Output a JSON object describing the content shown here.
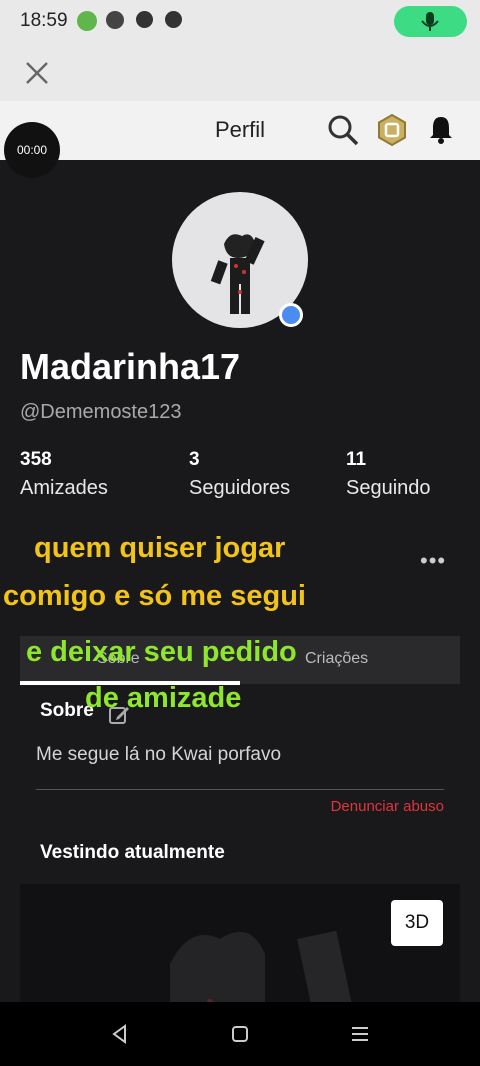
{
  "status_bar": {
    "time": "18:59"
  },
  "header": {
    "title": "Perfil",
    "recording_time": "00:00"
  },
  "profile": {
    "display_name": "Madarinha17",
    "username": "@Dememoste123"
  },
  "stats": [
    {
      "value": "358",
      "label": "Amizades"
    },
    {
      "value": "3",
      "label": "Seguidores"
    },
    {
      "value": "11",
      "label": "Seguindo"
    }
  ],
  "tabs": [
    {
      "label": "Sobre",
      "selected": true
    },
    {
      "label": "Criações",
      "selected": false
    }
  ],
  "about": {
    "title": "Sobre",
    "text": "Me segue lá no Kwai porfavo",
    "report_label": "Denunciar abuso"
  },
  "wearing": {
    "title": "Vestindo atualmente",
    "view_3d_label": "3D"
  },
  "overlay_caption": {
    "line1": "quem quiser jogar",
    "line2": "comigo e só me segui",
    "line3": "e deixar seu pedido",
    "line4": "de amizade"
  },
  "colors": {
    "background": "#19191b",
    "accent_online": "#4a8cf0",
    "report": "#e0343c",
    "caption_yellow": "#f2c318",
    "caption_green": "#8ee62d",
    "mic_pill": "#3ddc84"
  },
  "icons": [
    "close-icon",
    "search-icon",
    "robux-icon",
    "bell-icon",
    "edit-icon",
    "more-icon",
    "mic-icon",
    "back-nav-icon",
    "home-nav-icon",
    "recents-nav-icon"
  ]
}
